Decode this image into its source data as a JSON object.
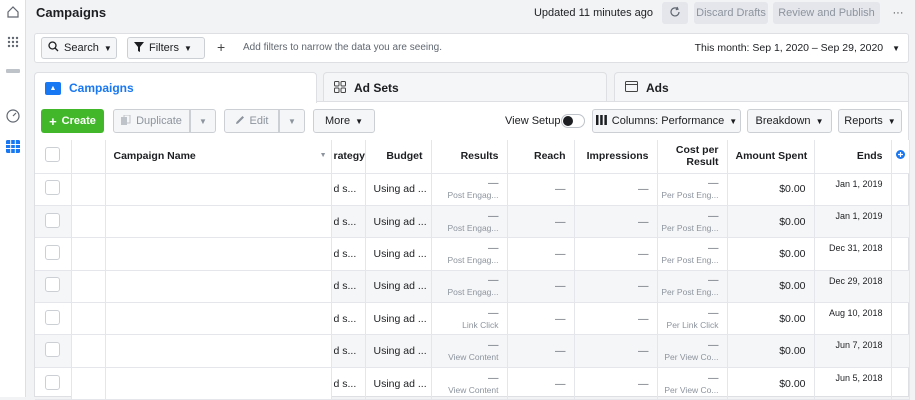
{
  "nav": {
    "icons": [
      "home-icon",
      "apps-grid-icon",
      "account-icon",
      "dashboard-gauge-icon",
      "campaign-table-icon"
    ]
  },
  "header": {
    "title": "Campaigns",
    "updated": "Updated 11 minutes ago",
    "discard_label": "Discard Drafts",
    "review_label": "Review and Publish",
    "more_label": "···"
  },
  "filterbar": {
    "search_label": "Search",
    "filters_label": "Filters",
    "plus_label": "+",
    "hint": "Add filters to narrow the data you are seeing.",
    "date_range": "This month: Sep 1, 2020 – Sep 29, 2020"
  },
  "tabs": [
    {
      "label": "Campaigns"
    },
    {
      "label": "Ad Sets"
    },
    {
      "label": "Ads"
    }
  ],
  "toolbar": {
    "create_label": "Create",
    "duplicate_label": "Duplicate",
    "edit_label": "Edit",
    "more_label": "More",
    "view_setup_label": "View Setup",
    "columns_label": "Columns: Performance",
    "breakdown_label": "Breakdown",
    "reports_label": "Reports"
  },
  "table": {
    "headers": {
      "name": "Campaign Name",
      "strategy": "rategy",
      "budget": "Budget",
      "results": "Results",
      "reach": "Reach",
      "impressions": "Impressions",
      "cost_line1": "Cost per",
      "cost_line2": "Result",
      "spent": "Amount Spent",
      "ends": "Ends"
    },
    "rows": [
      {
        "strategy": "d s...",
        "budget": "Using ad ...",
        "results": "—",
        "results_sub": "Post Engag...",
        "reach": "—",
        "impressions": "—",
        "cost": "—",
        "cost_sub": "Per Post Eng...",
        "spent": "$0.00",
        "ends": "Jan 1, 2019"
      },
      {
        "strategy": "d s...",
        "budget": "Using ad ...",
        "results": "—",
        "results_sub": "Post Engag...",
        "reach": "—",
        "impressions": "—",
        "cost": "—",
        "cost_sub": "Per Post Eng...",
        "spent": "$0.00",
        "ends": "Jan 1, 2019"
      },
      {
        "strategy": "d s...",
        "budget": "Using ad ...",
        "results": "—",
        "results_sub": "Post Engag...",
        "reach": "—",
        "impressions": "—",
        "cost": "—",
        "cost_sub": "Per Post Eng...",
        "spent": "$0.00",
        "ends": "Dec 31, 2018"
      },
      {
        "strategy": "d s...",
        "budget": "Using ad ...",
        "results": "—",
        "results_sub": "Post Engag...",
        "reach": "—",
        "impressions": "—",
        "cost": "—",
        "cost_sub": "Per Post Eng...",
        "spent": "$0.00",
        "ends": "Dec 29, 2018"
      },
      {
        "strategy": "d s...",
        "budget": "Using ad ...",
        "results": "—",
        "results_sub": "Link Click",
        "reach": "—",
        "impressions": "—",
        "cost": "—",
        "cost_sub": "Per Link Click",
        "spent": "$0.00",
        "ends": "Aug 10, 2018"
      },
      {
        "strategy": "d s...",
        "budget": "Using ad ...",
        "results": "—",
        "results_sub": "View Content",
        "reach": "—",
        "impressions": "—",
        "cost": "—",
        "cost_sub": "Per View Co...",
        "spent": "$0.00",
        "ends": "Jun 7, 2018"
      },
      {
        "strategy": "d s...",
        "budget": "Using ad ...",
        "results": "—",
        "results_sub": "View Content",
        "reach": "—",
        "impressions": "—",
        "cost": "—",
        "cost_sub": "Per View Co...",
        "spent": "$0.00",
        "ends": "Jun 5, 2018"
      }
    ]
  },
  "colors": {
    "accent": "#1877f2",
    "create_green": "#42b72a"
  }
}
